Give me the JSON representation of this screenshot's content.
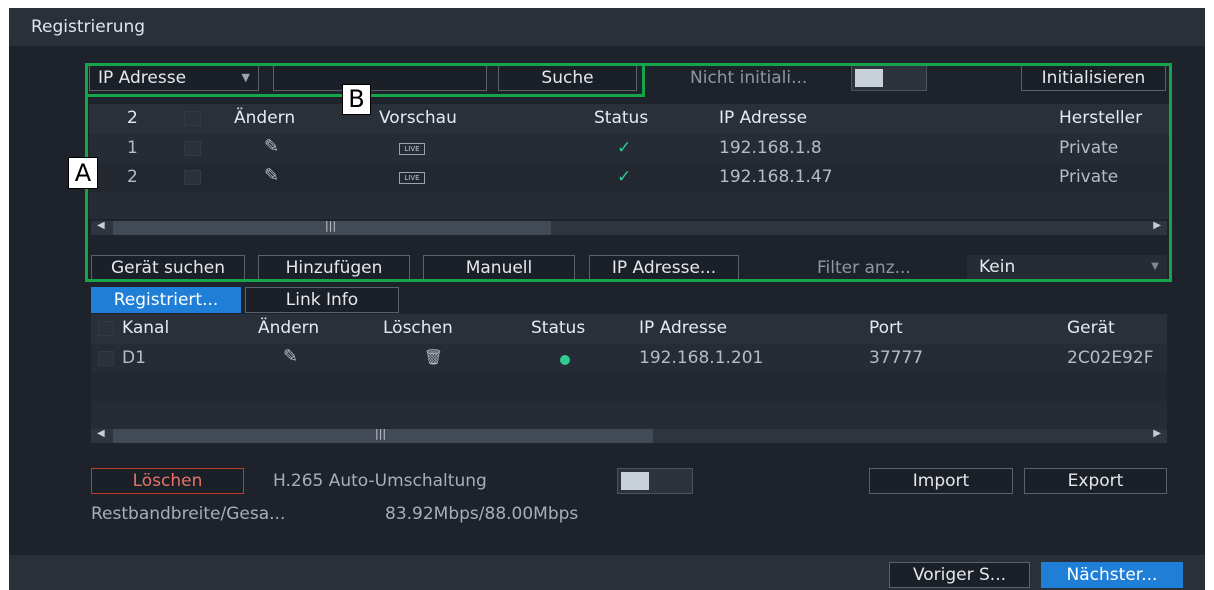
{
  "window": {
    "title": "Registrierung"
  },
  "search_bar": {
    "filter_type": "IP Adresse",
    "search_value": "",
    "search_button": "Suche",
    "uninit_label": "Nicht initiali...",
    "init_button": "Initialisieren"
  },
  "found_devices": {
    "columns": [
      "2",
      "Ändern",
      "Vorschau",
      "Status",
      "IP Adresse",
      "Hersteller"
    ],
    "rows": [
      {
        "no": "1",
        "ip": "192.168.1.8",
        "vendor": "Private",
        "live": "LIVE"
      },
      {
        "no": "2",
        "ip": "192.168.1.47",
        "vendor": "Private",
        "live": "LIVE"
      }
    ],
    "buttons": {
      "search": "Gerät suchen",
      "add": "Hinzufügen",
      "manual": "Manuell",
      "ip": "IP Adresse..."
    },
    "filter_label": "Filter anz...",
    "filter_value": "Kein"
  },
  "tabs": {
    "registered": "Registriert...",
    "link_info": "Link Info"
  },
  "registered_devices": {
    "columns": [
      "Kanal",
      "Ändern",
      "Löschen",
      "Status",
      "IP Adresse",
      "Port",
      "Gerät"
    ],
    "rows": [
      {
        "channel": "D1",
        "ip": "192.168.1.201",
        "port": "37777",
        "device": "2C02E92F"
      }
    ]
  },
  "bottom": {
    "delete_button": "Löschen",
    "h265_label": "H.265 Auto-Umschaltung",
    "import_button": "Import",
    "export_button": "Export",
    "bandwidth_label": "Restbandbreite/Gesa...",
    "bandwidth_value": "83.92Mbps/88.00Mbps"
  },
  "footer": {
    "prev_button": "Voriger S...",
    "next_button": "Nächster..."
  },
  "annotations": {
    "a": "A",
    "b": "B"
  },
  "colors": {
    "accent": "#1f7fd6",
    "status_ok": "#2ecc8f",
    "highlight": "#16a34a",
    "delete_border": "#c0392b"
  }
}
